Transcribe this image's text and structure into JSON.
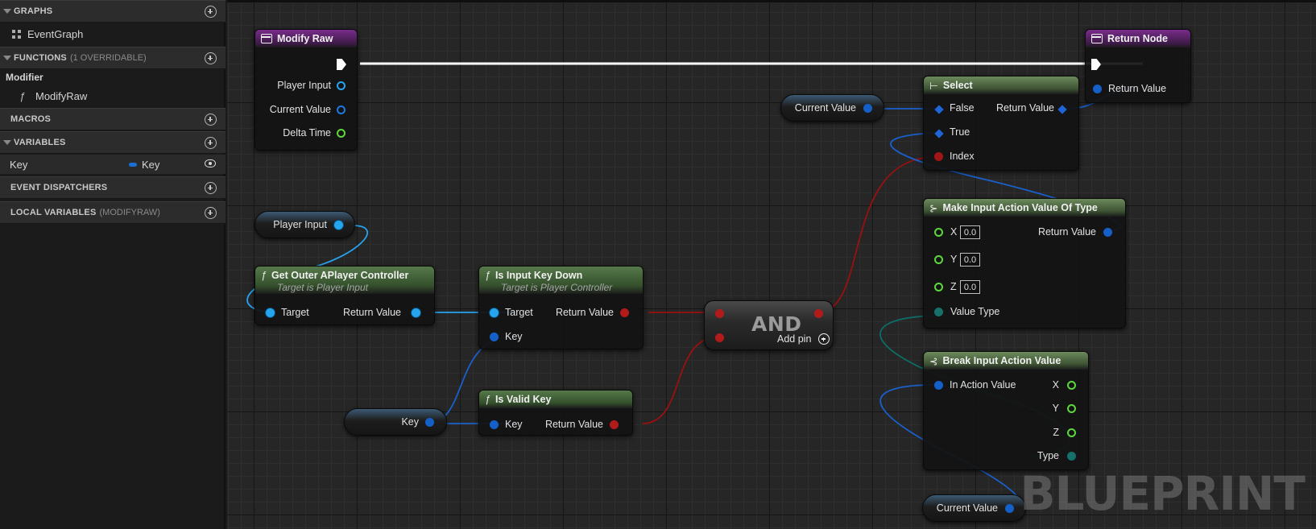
{
  "sidebar": {
    "graphs_header": "GRAPHS",
    "event_graph": "EventGraph",
    "functions_header": "FUNCTIONS",
    "functions_sub": "(1 OVERRIDABLE)",
    "function_group": "Modifier",
    "function_item": "ModifyRaw",
    "macros_header": "MACROS",
    "variables_header": "VARIABLES",
    "variable_name": "Key",
    "variable_type": "Key",
    "variable_type_color": "#1a6fd6",
    "dispatchers_header": "EVENT DISPATCHERS",
    "local_vars_header": "LOCAL VARIABLES",
    "local_vars_sub": "(MODIFYRAW)"
  },
  "nodes": {
    "modify_raw": {
      "title": "Modify Raw",
      "pins": [
        "Player Input",
        "Current Value",
        "Delta Time"
      ]
    },
    "return_node": {
      "title": "Return Node",
      "pin": "Return Value"
    },
    "player_input_get": {
      "label": "Player Input"
    },
    "get_outer": {
      "title": "Get Outer APlayer Controller",
      "subtitle": "Target is Player Input",
      "in_pin": "Target",
      "out_pin": "Return Value"
    },
    "is_input_key_down": {
      "title": "Is Input Key Down",
      "subtitle": "Target is Player Controller",
      "in_pins": [
        "Target",
        "Key"
      ],
      "out_pin": "Return Value"
    },
    "key_get": {
      "label": "Key"
    },
    "is_valid_key": {
      "title": "Is Valid Key",
      "in_pin": "Key",
      "out_pin": "Return Value"
    },
    "and_node": {
      "title": "AND",
      "add_pin": "Add pin"
    },
    "current_value_get_top": {
      "label": "Current Value"
    },
    "select": {
      "title": "Select",
      "in_pins": [
        "False",
        "True",
        "Index"
      ],
      "out_pin": "Return Value"
    },
    "make_input_action": {
      "title": "Make Input Action Value Of Type",
      "in_pins": [
        "X",
        "Y",
        "Z",
        "Value Type"
      ],
      "defaults": [
        "0.0",
        "0.0",
        "0.0"
      ],
      "out_pin": "Return Value"
    },
    "break_input_action": {
      "title": "Break Input Action Value",
      "in_pin": "In Action Value",
      "out_pins": [
        "X",
        "Y",
        "Z",
        "Type"
      ]
    },
    "current_value_get_bottom": {
      "label": "Current Value"
    }
  },
  "colors": {
    "object_pin": "#27a4ee",
    "struct_pin": "#1560c8",
    "bool_pin": "#b31b1b",
    "float_pin": "#5dd83c",
    "enum_pin": "#17706b",
    "event_header": "#7a2c8c",
    "pure_header": "#6c8a5c"
  },
  "watermark": "BLUEPRINT"
}
